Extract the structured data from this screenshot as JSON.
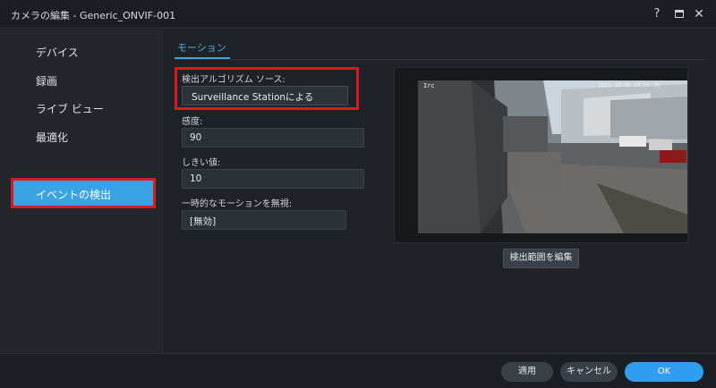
{
  "window": {
    "title": "カメラの編集 - Generic_ONVIF-001",
    "help_glyph": "?",
    "close_glyph": "✕"
  },
  "sidebar": {
    "items": [
      {
        "label": "デバイス",
        "active": false
      },
      {
        "label": "録画",
        "active": false
      },
      {
        "label": "ライブ ビュー",
        "active": false
      },
      {
        "label": "最適化",
        "active": false
      },
      {
        "label": "イベントの検出",
        "active": true
      }
    ]
  },
  "main": {
    "tab": "モーション",
    "algorithm_label": "検出アルゴリズム ソース:",
    "algorithm_value": "Surveillance Stationによる",
    "sensitivity_label": "感度:",
    "sensitivity_value": "90",
    "threshold_label": "しきい値:",
    "threshold_value": "10",
    "ignore_label": "一時的なモーションを無視:",
    "ignore_value": "[無効]",
    "edit_area_button": "検出範囲を編集"
  },
  "preview": {
    "overlay_left": "Irc",
    "overlay_right": "2021-10-06 14:55:36"
  },
  "footer": {
    "apply": "適用",
    "cancel": "キャンセル",
    "ok": "OK"
  },
  "colors": {
    "accent": "#3aa3e6",
    "highlight_border": "#d81b22",
    "ok_button": "#2f9ef0"
  }
}
